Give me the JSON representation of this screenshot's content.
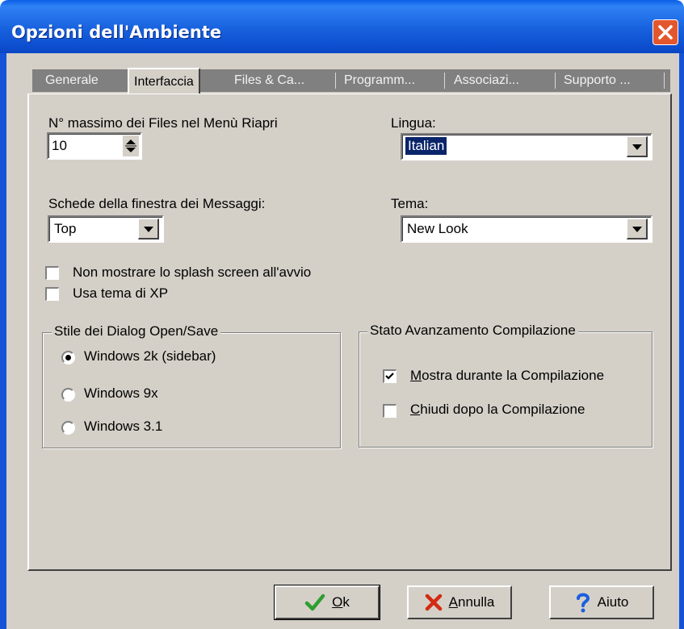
{
  "window": {
    "title": "Opzioni dell'Ambiente"
  },
  "tabs": [
    {
      "label": "Generale",
      "active": false
    },
    {
      "label": "Interfaccia",
      "active": true
    },
    {
      "label": "Files & Ca...",
      "active": false
    },
    {
      "label": "Programm...",
      "active": false
    },
    {
      "label": "Associazi...",
      "active": false
    },
    {
      "label": "Supporto ...",
      "active": false
    }
  ],
  "recent_files": {
    "label": "N° massimo dei Files nel Menù Riapri",
    "value": "10"
  },
  "language": {
    "label": "Lingua:",
    "value": "Italian"
  },
  "message_tabs": {
    "label": "Schede della finestra dei Messaggi:",
    "value": "Top"
  },
  "theme": {
    "label": "Tema:",
    "value": "New Look"
  },
  "checkboxes": [
    {
      "label": "Non mostrare lo splash screen all'avvio",
      "checked": false
    },
    {
      "label": "Usa tema di XP",
      "checked": false
    }
  ],
  "dialog_style": {
    "legend": "Stile dei Dialog Open/Save",
    "options": [
      {
        "label": "Windows 2k (sidebar)",
        "selected": true
      },
      {
        "label": "Windows 9x",
        "selected": false
      },
      {
        "label": "Windows 3.1",
        "selected": false
      }
    ]
  },
  "compile_progress": {
    "legend": "Stato Avanzamento Compilazione",
    "show": {
      "mnemonic": "M",
      "rest": "ostra durante la Compilazione",
      "checked": true
    },
    "close": {
      "mnemonic": "C",
      "rest": "hiudi dopo la Compilazione",
      "checked": false
    }
  },
  "buttons": {
    "ok": {
      "mnemonic": "O",
      "rest": "k"
    },
    "cancel": {
      "mnemonic": "A",
      "rest": "nnulla"
    },
    "help": {
      "label": "Aiuto"
    }
  },
  "colors": {
    "titlebar": "#1a64e0",
    "face": "#d4d0c8",
    "selection": "#0a246a",
    "close": "#e3572e"
  },
  "icons": {
    "ok": "checkmark-icon",
    "cancel": "x-mark-icon",
    "help": "question-mark-icon",
    "close": "close-icon"
  }
}
